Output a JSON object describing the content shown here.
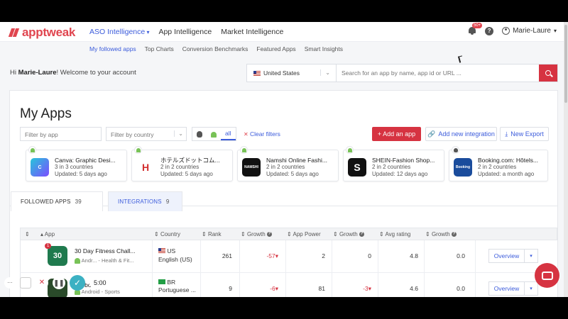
{
  "brand": {
    "name": "apptweak",
    "accent": "#e0454f",
    "link": "#3b5bdb"
  },
  "nav": {
    "items": [
      "ASO Intelligence",
      "App Intelligence",
      "Market Intelligence"
    ],
    "notif_count": "50+",
    "user": "Marie-Laure"
  },
  "subnav": [
    "My followed apps",
    "Top Charts",
    "Conversion Benchmarks",
    "Featured Apps",
    "Smart Insights"
  ],
  "welcome": {
    "prefix": "Hi ",
    "name": "Marie-Laure",
    "suffix": "! Welcome to your account"
  },
  "search": {
    "country": "United States",
    "placeholder": "Search for an app by name, app id or URL ..."
  },
  "page": {
    "title": "My Apps"
  },
  "filters": {
    "app_placeholder": "Filter by app",
    "country_placeholder": "Filter by country",
    "platform_all": "all",
    "clear": "Clear filters"
  },
  "actions": {
    "add_app": "+ Add an app",
    "add_integration": "Add new integration",
    "export": "New Export"
  },
  "cards": [
    {
      "platform": "android",
      "name": "Canva: Graphic Desi...",
      "countries": "3 in 3 countries",
      "updated": "Updated: 5 days ago",
      "color": "#3a7bd5",
      "icon": "C"
    },
    {
      "platform": "android",
      "name": "ホテルズドットコム...",
      "countries": "2 in 2 countries",
      "updated": "Updated: 5 days ago",
      "color": "#d32f2f",
      "icon": "H"
    },
    {
      "platform": "android",
      "name": "Namshi Online Fashi...",
      "countries": "2 in 2 countries",
      "updated": "Updated: 5 days ago",
      "color": "#111111",
      "icon": "NAMSHI"
    },
    {
      "platform": "android",
      "name": "SHEIN-Fashion Shop...",
      "countries": "2 in 2 countries",
      "updated": "Updated: 12 days ago",
      "color": "#111111",
      "icon": "S"
    },
    {
      "platform": "apple",
      "name": "Booking.com: Hôtels...",
      "countries": "2 in 2 countries",
      "updated": "Updated: a month ago",
      "color": "#1a4c9c",
      "icon": "Booking"
    }
  ],
  "tabs": [
    {
      "label": "FOLLOWED APPS",
      "count": "39"
    },
    {
      "label": "INTEGRATIONS",
      "count": "9"
    }
  ],
  "table": {
    "headers": {
      "app": "App",
      "country": "Country",
      "rank": "Rank",
      "growth": "Growth",
      "power": "App Power",
      "rating": "Avg rating"
    },
    "rows": [
      {
        "notif": "1",
        "name": "30 Day Fitness Chall...",
        "sub": "Andr... - Health & Fit...",
        "country_code": "US",
        "language": "English (US)",
        "rank": "261",
        "rank_growth": "-57▾",
        "power": "2",
        "power_growth": "0",
        "rating": "4.8",
        "rating_growth": "0.0",
        "action": "Overview",
        "icon_color": "#1f7a4e"
      },
      {
        "notif": "",
        "name": "...tebol ...",
        "sub": "Android - Sports",
        "country_code": "BR",
        "language": "Portuguese ...",
        "rank": "9",
        "rank_growth": "-6▾",
        "power": "81",
        "power_growth": "-3▾",
        "rating": "4.6",
        "rating_growth": "0.0",
        "action": "Overview",
        "icon_color": "#2a4a2a"
      }
    ]
  },
  "recorder": {
    "time": "5:00"
  }
}
